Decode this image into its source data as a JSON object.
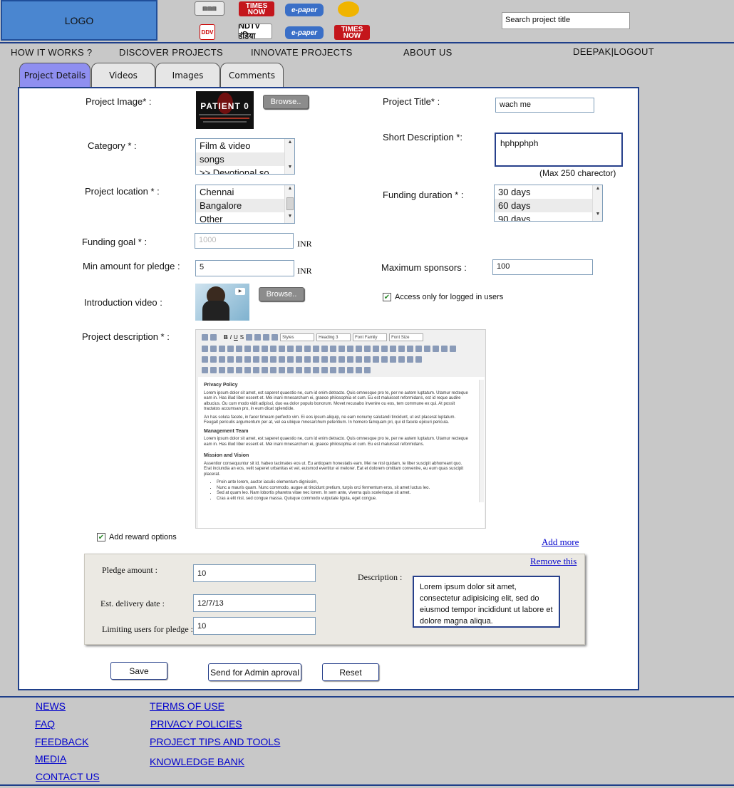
{
  "header": {
    "logo_text": "LOGO",
    "media_logos_row1": [
      "TIMES NOW",
      "e-paper",
      ""
    ],
    "media_logos_row2": [
      "DDV",
      "NDTV इंडिया",
      "e-paper",
      "TIMES NOW"
    ],
    "search_value": "Search project title"
  },
  "nav": {
    "how_it_works": "HOW IT WORKS ?",
    "discover": "DISCOVER PROJECTS",
    "innovate": "INNOVATE PROJECTS",
    "about": "ABOUT US",
    "user": "DEEPAK|LOGOUT"
  },
  "tabs": [
    "Project Details",
    "Videos",
    "Images",
    "Comments"
  ],
  "form": {
    "project_image_label": "Project Image* :",
    "project_image_text": "PATIENT 0",
    "browse_label": "Browse..",
    "project_title_label": "Project Title* :",
    "project_title_value": "wach me",
    "category_label": "Category * :",
    "category_options": [
      "Film & video",
      "songs",
      ">> Devotional so"
    ],
    "short_desc_label": "Short Description *:",
    "short_desc_value": "hphpphph",
    "short_desc_hint": "(Max 250 charector)",
    "location_label": "Project location * :",
    "location_options": [
      "Chennai",
      "Bangalore",
      "Other"
    ],
    "duration_label": "Funding duration * :",
    "duration_options": [
      "30 days",
      "60 days",
      "90 days"
    ],
    "funding_goal_label": "Funding goal * :",
    "funding_goal_placeholder": "1000",
    "currency": "INR",
    "min_amount_label": "Min amount for pledge :",
    "min_amount_value": "5",
    "max_sponsors_label": "Maximum sponsors  :",
    "max_sponsors_value": "100",
    "intro_video_label": "Introduction video :",
    "logged_in_label": "Access only for logged in users",
    "description_label": "Project description * :",
    "add_reward_label": "Add reward options",
    "add_more_label": "Add more"
  },
  "editor": {
    "selects": [
      "Styles",
      "Heading 3",
      "Font Family",
      "Font Size"
    ],
    "heading1": "Privacy Policy",
    "para1": "Lorem ipsum dolor sit amet, est saperet quaestio ne, cum id enim detracto. Quis omnesque pro te, per ne autem luptatum. Utamur recteque eam in. Has illud liber essent et. Mei inani mnesarchum ei, graece philosophia et cum. Eu est maluisset reformidans, est id reque audire albucius. Ou cum modo vidit adipisci, duo ea dolor populo bonorum. Movet recusabo invenire ou eos, tem commune ex qui. At possit tractatos accumsan pro, in eum dicat splendide.",
    "para2": "An has soluta facete, in facer timeam perfecto vim. Ei eos ipsum aliquip, ne eam nonumy salutandi tincidunt, ut est placerat luptatum. Feugait periculis argumentum per at, vel ea ubique mnesarchum petentium. In homero tamquam pri, qui id facete epicuri pericula.",
    "heading2": "Management Team",
    "para3": "Lorem ipsum dolor sit amet, est saperet quaestio ne, cum id enim detracto. Quis omnesque pro te, per ne autem luptatum. Utamur recteque eam in. Has illud liber essent et. Mei inani mnesarchum ei, graece philosophia et cum. Eu est maluisset reformidans.",
    "heading3": "Mission and Vision",
    "para4": "Assentior consequuntur sit id, habeo tacimates eos ut. Eu antiopam honestatis eam. Mei ne nisl quidam, te liber suscipit abhorreant quo. Erat inciundia an eos, velit saperet urbanitas et vel, euismod evertitur ei melorer. Eat et dolorem omittam convenire, eu eum quas suscipit placerat.",
    "bullets": [
      "Proin ante lorem, auctor iaculis elementum dignissim,",
      "Nunc a mauris quam. Nunc commodo, augue at tincidunt pretium, turpis orci fermentum eros, sit amet luctus leo.",
      "Sed at quam leo. Nam lobortis pharetra vitae nec lorem. In sem ante, viverra quis scelerisque sit amet.",
      "Cras a elit nisl, sed congue massa. Quisque commodo vulputate ligula, eget congue."
    ]
  },
  "reward": {
    "remove_label": "Remove this",
    "pledge_label": "Pledge amount :",
    "pledge_value": "10",
    "delivery_label": "Est. delivery date :",
    "delivery_value": "12/7/13",
    "limit_label": "Limiting users for pledge :",
    "limit_value": "10",
    "description_label": "Description :",
    "description_value": "Lorem ipsum dolor sit amet, consectetur adipisicing elit, sed do eiusmod tempor incididunt ut labore et dolore magna aliqua."
  },
  "actions": {
    "save": "Save",
    "send_admin": "Send for Admin aproval",
    "reset": "Reset"
  },
  "footer": {
    "col1": [
      "NEWS",
      "FAQ",
      "FEEDBACK",
      "MEDIA",
      "CONTACT US"
    ],
    "col2": [
      "TERMS OF USE",
      "PRIVACY POLICIES",
      "PROJECT TIPS AND TOOLS",
      "KNOWLEDGE BANK"
    ]
  }
}
